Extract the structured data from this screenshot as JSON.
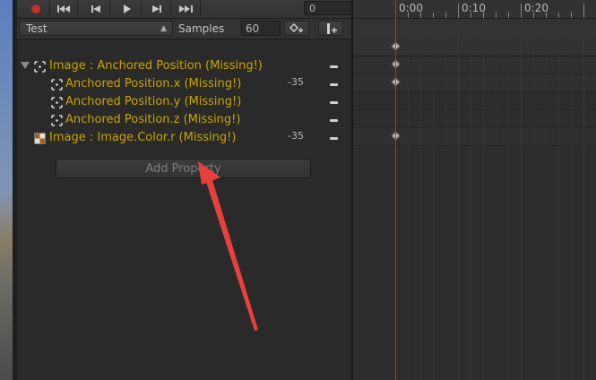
{
  "toolbar": {
    "frame_value": "0"
  },
  "clip": {
    "name": "Test",
    "samples_label": "Samples",
    "samples_value": "60"
  },
  "properties": [
    {
      "label": "Image : Anchored Position (Missing!)",
      "value": ""
    },
    {
      "label": "Anchored Position.x (Missing!)",
      "value": "-35"
    },
    {
      "label": "Anchored Position.y (Missing!)",
      "value": ""
    },
    {
      "label": "Anchored Position.z (Missing!)",
      "value": ""
    },
    {
      "label": "Image : Image.Color.r (Missing!)",
      "value": "-35"
    }
  ],
  "add_property_label": "Add Property",
  "timeline": {
    "ticks": [
      "0:00",
      "0:10",
      "0:20"
    ]
  },
  "colors": {
    "missing_text": "#c9a400",
    "playhead": "#e02020",
    "record": "#c0312b",
    "annotation_arrow": "#e8403a"
  },
  "icons": {
    "record": "record-icon",
    "first_key": "skip-first-icon",
    "prev_key": "prev-key-icon",
    "play": "play-icon",
    "next_key": "next-key-icon",
    "last_key": "skip-last-icon",
    "add_keyframe": "add-keyframe-icon",
    "add_event": "add-event-icon",
    "rect_transform": "rect-transform-icon",
    "image_component": "image-component-icon"
  }
}
